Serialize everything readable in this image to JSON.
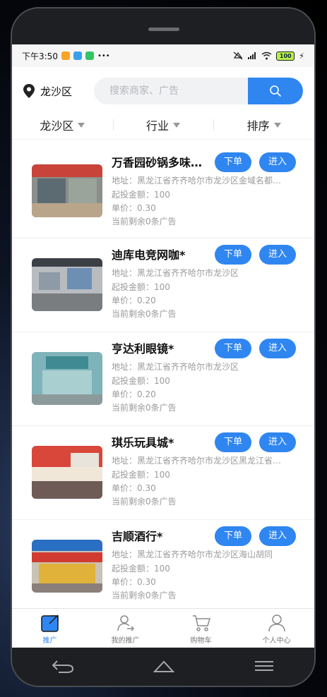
{
  "statusbar": {
    "time": "下午3:50",
    "dots": "•••",
    "battery": "100"
  },
  "location": {
    "name": "龙沙区"
  },
  "search": {
    "placeholder": "搜索商家、广告"
  },
  "filters": [
    {
      "label": "龙沙区"
    },
    {
      "label": "行业"
    },
    {
      "label": "排序"
    }
  ],
  "buttons": {
    "order": "下单",
    "enter": "进入"
  },
  "items": [
    {
      "name": "万香园砂锅多味…",
      "address": "地址：黑龙江省齐齐哈尔市龙沙区金域名都…",
      "amount": "起投金额：100",
      "price": "单价：0.30",
      "remain": "当前剩余0条广告"
    },
    {
      "name": "迪库电竞网咖*",
      "address": "地址：黑龙江省齐齐哈尔市龙沙区",
      "amount": "起投金额：100",
      "price": "单价：0.20",
      "remain": "当前剩余0条广告"
    },
    {
      "name": "亨达利眼镜*",
      "address": "地址：黑龙江省齐齐哈尔市龙沙区",
      "amount": "起投金额：100",
      "price": "单价：0.20",
      "remain": "当前剩余0条广告"
    },
    {
      "name": "琪乐玩具城*",
      "address": "地址：黑龙江省齐齐哈尔市龙沙区黑龙江省…",
      "amount": "起投金额：100",
      "price": "单价：0.30",
      "remain": "当前剩余0条广告"
    },
    {
      "name": "吉顺酒行*",
      "address": "地址：黑龙江省齐齐哈尔市龙沙区海山胡同",
      "amount": "起投金额：100",
      "price": "单价：0.30",
      "remain": "当前剩余0条广告"
    }
  ],
  "tabbar": [
    {
      "label": "推广",
      "icon": "promote-icon",
      "active": true
    },
    {
      "label": "我的推广",
      "icon": "my-promote-icon"
    },
    {
      "label": "购物车",
      "icon": "cart-icon"
    },
    {
      "label": "个人中心",
      "icon": "user-icon"
    }
  ],
  "colors": {
    "accent": "#2f86f0"
  }
}
